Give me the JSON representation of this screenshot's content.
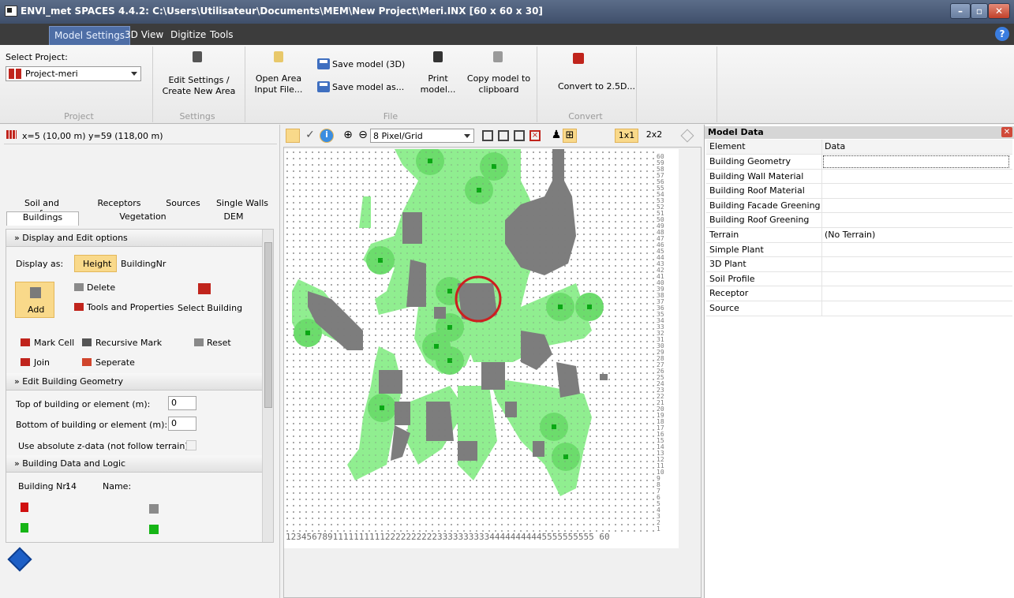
{
  "window": {
    "title": "ENVI_met SPACES 4.4.2: C:\\Users\\Utilisateur\\Documents\\MEM\\New Project\\Meri.INX [60 x 60 x 30]"
  },
  "ribbon_tabs": [
    "Model Settings",
    "3D View",
    "Digitize",
    "Tools"
  ],
  "ribbon": {
    "select_project_label": "Select Project:",
    "project_value": "Project-meri",
    "edit_settings": "Edit Settings /",
    "create_new_area": "Create New Area",
    "open_area": "Open Area",
    "input_file": "Input File...",
    "save_3d": "Save model (3D)",
    "save_as": "Save model as...",
    "print_1": "Print",
    "print_2": "model...",
    "copy_1": "Copy model to",
    "copy_2": "clipboard",
    "convert": "Convert to 2.5D...",
    "groups": [
      "Project",
      "Settings",
      "File",
      "Convert"
    ]
  },
  "left_panel": {
    "coords": "x=5 (10,00 m) y=59 (118,00 m)",
    "tabs_row1": [
      "Soil and surface",
      "Receptors",
      "Sources",
      "Single Walls"
    ],
    "tabs_row2": [
      "Buildings",
      "Vegetation",
      "DEM"
    ],
    "section_display": "Display and Edit options",
    "display_as": "Display as:",
    "height": "Height",
    "buildingnr": "BuildingNr",
    "add": "Add",
    "delete": "Delete",
    "tools_props": "Tools and Properties",
    "select_building": "Select Building",
    "mark_cell": "Mark Cell",
    "recursive_mark": "Recursive Mark",
    "reset": "Reset",
    "join": "Join",
    "seperate": "Seperate",
    "section_geometry": "Edit Building Geometry",
    "top_label": "Top of building or element (m):",
    "top_value": "0",
    "bottom_label": "Bottom of building or element (m):",
    "bottom_value": "0",
    "absolute_z": "Use absolute z-data (not follow terrain)",
    "section_data": "Building Data and Logic",
    "building_nr_label": "Building Nr:",
    "building_nr_value": "14",
    "name_label": "Name:"
  },
  "canvas_toolbar": {
    "zoom_select": "8 Pixel/Grid",
    "scale_1x1": "1x1",
    "scale_2x2": "2x2"
  },
  "map": {
    "x_axis_label": "12345678911111111112222222222333333333344444444445555555555 60",
    "y_axis_labels": [
      "60",
      "59",
      "58",
      "57",
      "56",
      "55",
      "54",
      "53",
      "52",
      "51",
      "50",
      "49",
      "48",
      "47",
      "46",
      "45",
      "44",
      "43",
      "42",
      "41",
      "40",
      "39",
      "38",
      "37",
      "36",
      "35",
      "34",
      "33",
      "32",
      "31",
      "30",
      "29",
      "28",
      "27",
      "26",
      "25",
      "24",
      "23",
      "22",
      "21",
      "20",
      "19",
      "18",
      "17",
      "16",
      "15",
      "14",
      "13",
      "12",
      "11",
      "10",
      "9",
      "8",
      "7",
      "6",
      "5",
      "4",
      "3",
      "2",
      "1"
    ],
    "colors": {
      "building": "#7d7d7d",
      "vegetation": "#90ee90",
      "tree": "#6cdc6c",
      "tree_center": "#0aa814",
      "highlight": "#cc1f1f"
    }
  },
  "model_data": {
    "title": "Model Data",
    "col_element": "Element",
    "col_data": "Data",
    "rows": [
      {
        "k": "Building Geometry",
        "v": ""
      },
      {
        "k": "Building Wall Material",
        "v": ""
      },
      {
        "k": "Building Roof Material",
        "v": ""
      },
      {
        "k": "Building Facade Greening",
        "v": ""
      },
      {
        "k": "Building Roof Greening",
        "v": ""
      },
      {
        "k": "Terrain",
        "v": "(No Terrain)"
      },
      {
        "k": "Simple Plant",
        "v": ""
      },
      {
        "k": "3D Plant",
        "v": ""
      },
      {
        "k": "Soil Profile",
        "v": ""
      },
      {
        "k": "Receptor",
        "v": ""
      },
      {
        "k": "Source",
        "v": ""
      }
    ]
  }
}
